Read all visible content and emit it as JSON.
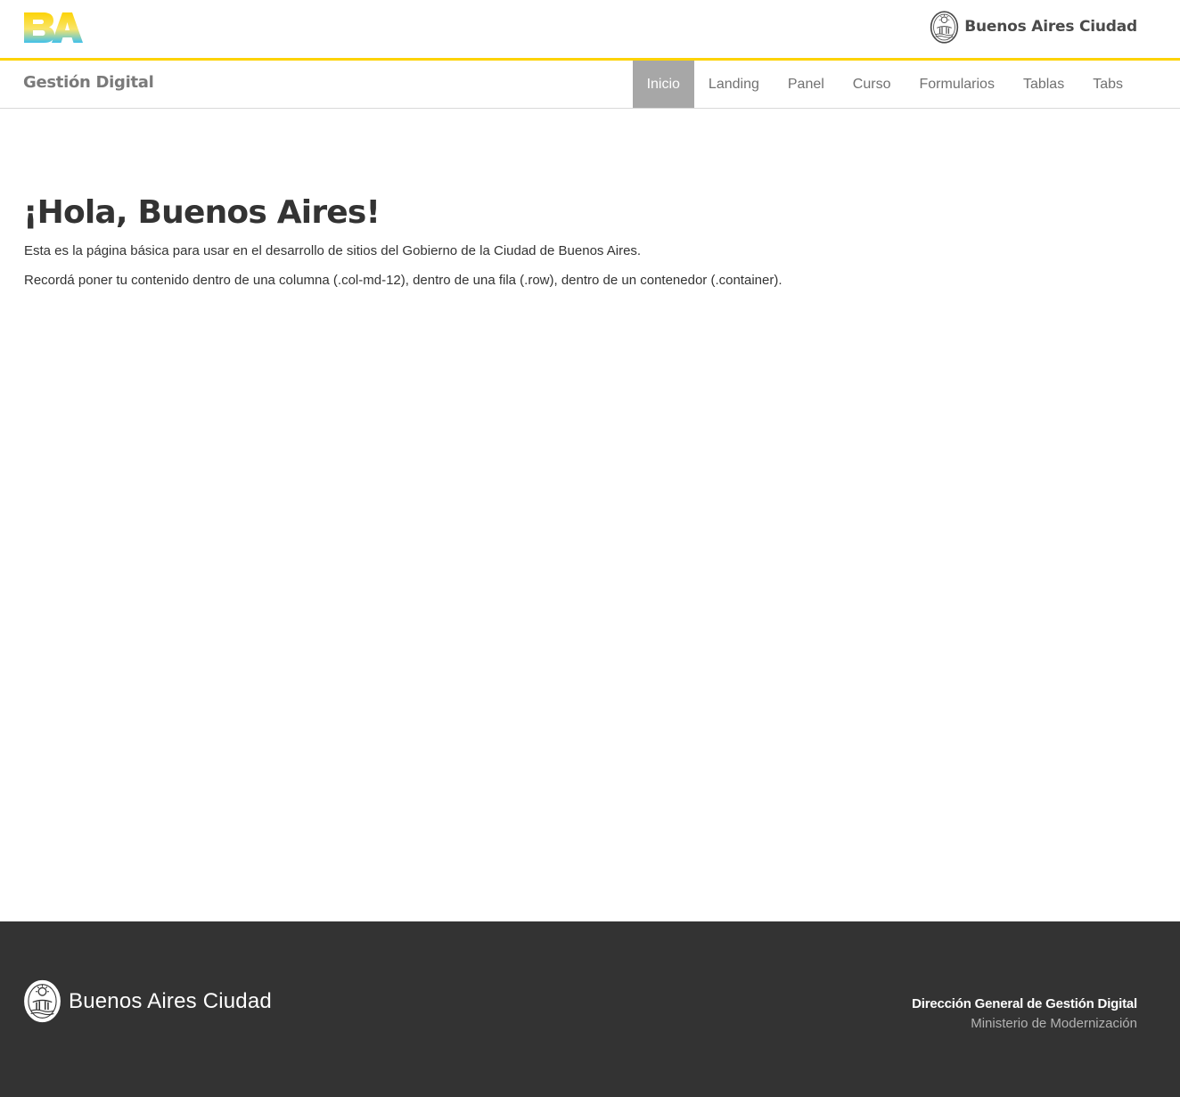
{
  "colors": {
    "accent_yellow": "#fdd306",
    "logo_gradient_top": "#fdd306",
    "logo_gradient_bottom": "#4cc1e8",
    "nav_active_bg": "#a7a7a7",
    "footer_bg": "#333333"
  },
  "topbar": {
    "logo_icon": "ba-logo-icon",
    "brand_right": {
      "icon": "city-seal-icon",
      "text": "Buenos Aires Ciudad"
    }
  },
  "navbar": {
    "brand": "Gestión Digital",
    "items": [
      {
        "label": "Inicio",
        "active": true
      },
      {
        "label": "Landing",
        "active": false
      },
      {
        "label": "Panel",
        "active": false
      },
      {
        "label": "Curso",
        "active": false
      },
      {
        "label": "Formularios",
        "active": false
      },
      {
        "label": "Tablas",
        "active": false
      },
      {
        "label": "Tabs",
        "active": false
      }
    ]
  },
  "main": {
    "title": "¡Hola, Buenos Aires!",
    "paragraphs": [
      "Esta es la página básica para usar en el desarrollo de sitios del Gobierno de la Ciudad de Buenos Aires.",
      "Recordá poner tu contenido dentro de una columna (.col-md-12), dentro de una fila (.row), dentro de un contenedor (.container)."
    ]
  },
  "footer": {
    "brand": {
      "icon": "city-seal-icon",
      "text": "Buenos Aires Ciudad"
    },
    "department": "Dirección General de Gestión Digital",
    "ministry": "Ministerio de Modernización"
  }
}
